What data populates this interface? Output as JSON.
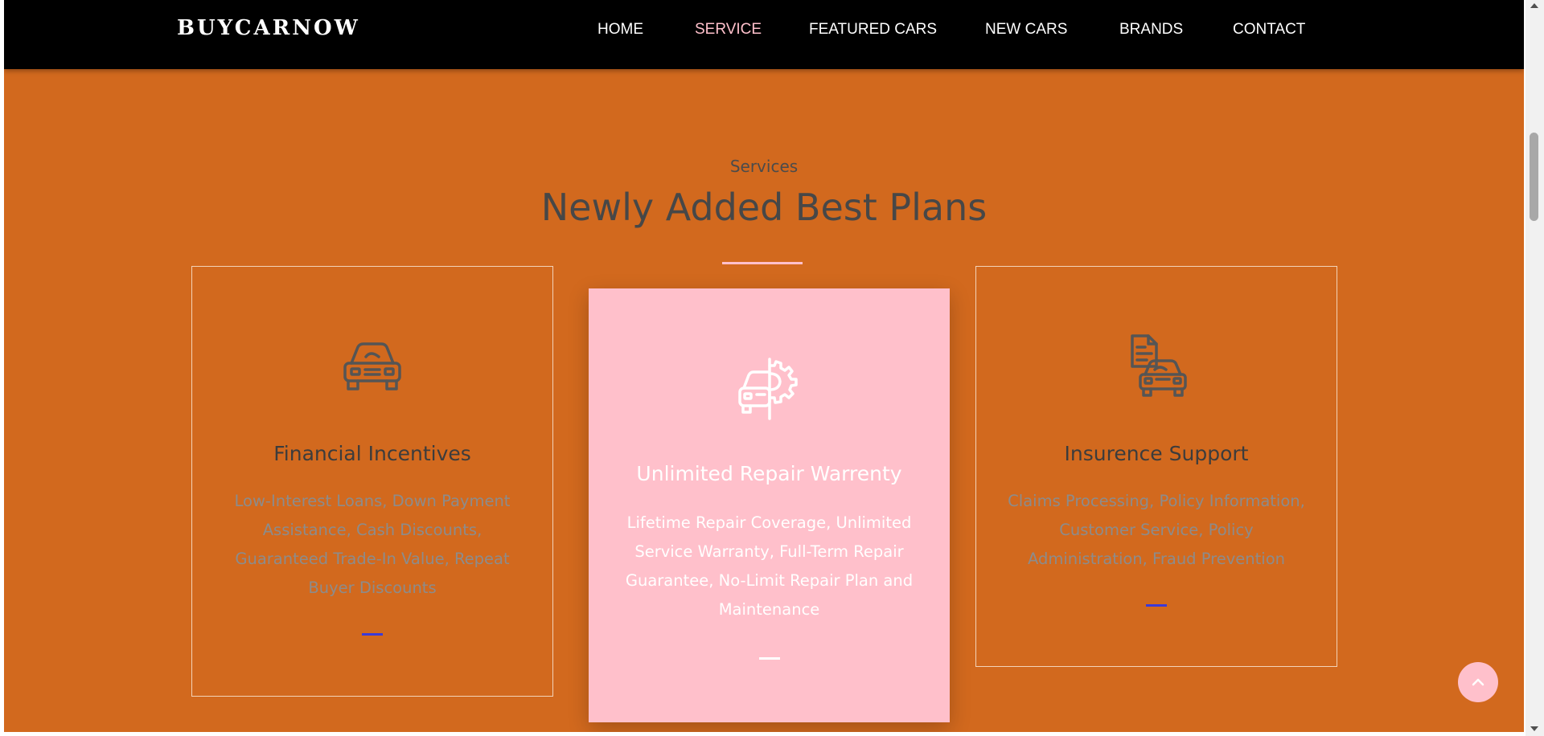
{
  "brand": {
    "name": "BUYCARNOW"
  },
  "nav": {
    "items": [
      {
        "label": "HOME",
        "active": false
      },
      {
        "label": "SERVICE",
        "active": true
      },
      {
        "label": "FEATURED CARS",
        "active": false
      },
      {
        "label": "NEW CARS",
        "active": false
      },
      {
        "label": "BRANDS",
        "active": false
      },
      {
        "label": "CONTACT",
        "active": false
      }
    ]
  },
  "services": {
    "subtitle": "Services",
    "title": "Newly Added Best Plans",
    "cards": [
      {
        "icon": "car-icon",
        "title": "Financial Incentives",
        "text": "Low-Interest Loans, Down Payment Assistance, Cash Discounts, Guaranteed Trade-In Value, Repeat Buyer Discounts"
      },
      {
        "icon": "car-gear-icon",
        "title": "Unlimited Repair Warrenty",
        "text": "Lifetime Repair Coverage, Unlimited Service Warranty, Full-Term Repair Guarantee, No-Limit Repair Plan and Maintenance"
      },
      {
        "icon": "car-document-icon",
        "title": "Insurence Support",
        "text": "Claims Processing, Policy Information, Customer Service, Policy Administration, Fraud Prevention"
      }
    ]
  },
  "colors": {
    "page_background": "#d2691e",
    "navbar": "#000000",
    "accent_pink": "#ffc0cb",
    "dash_blue": "#3a3ad8"
  },
  "scroll_top": {
    "icon": "chevron-up-icon"
  }
}
